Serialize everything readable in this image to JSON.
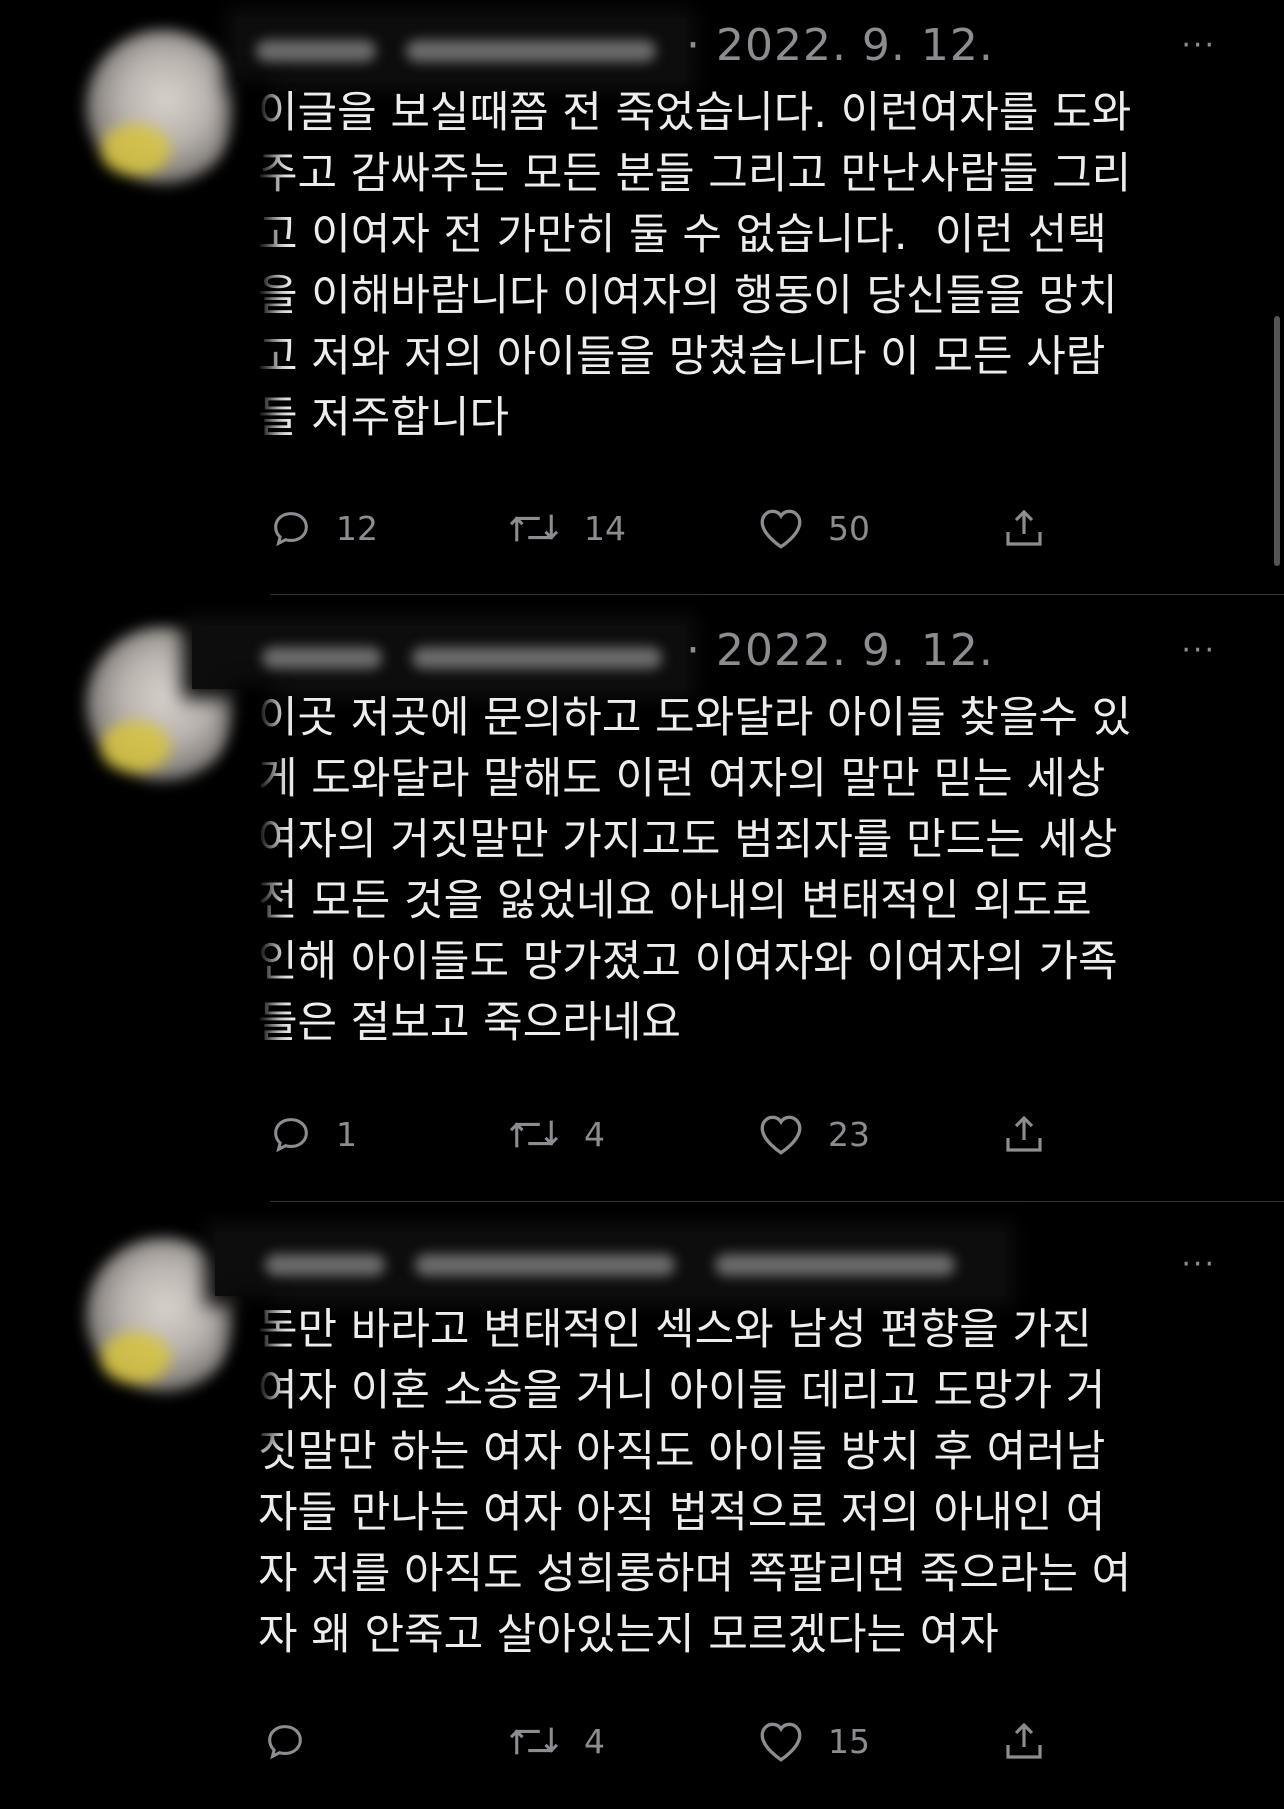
{
  "tweets": [
    {
      "date": "· 2022. 9. 12.",
      "more": "···",
      "text": "이글을 보실때쯤 전 죽었습니다. 이런여자를 도와\n주고 감싸주는 모든 분들 그리고 만난사람들 그리\n고 이여자 전 가만히 둘 수 없습니다.  이런 선택\n을 이해바람니다 이여자의 행동이 당신들을 망치\n고 저와 저의 아이들을 망쳤습니다 이 모든 사람\n들 저주합니다",
      "replies": "12",
      "retweets": "14",
      "likes": "50"
    },
    {
      "date": "· 2022. 9. 12.",
      "more": "···",
      "text": "이곳 저곳에 문의하고 도와달라 아이들 찾을수 있\n게 도와달라 말해도 이런 여자의 말만 믿는 세상\n여자의 거짓말만 가지고도 범죄자를 만드는 세상\n전 모든 것을 잃었네요 아내의 변태적인 외도로\n인해 아이들도 망가졌고 이여자와 이여자의 가족\n들은 절보고 죽으라네요",
      "replies": "1",
      "retweets": "4",
      "likes": "23"
    },
    {
      "date": "",
      "more": "···",
      "text": "돈만 바라고 변태적인 섹스와 남성 편향을 가진\n여자 이혼 소송을 거니 아이들 데리고 도망가 거\n짓말만 하는 여자 아직도 아이들 방치 후 여러남\n자들 만나는 여자 아직 법적으로 저의 아내인 여\n자 저를 아직도 성희롱하며 쪽팔리면 죽으라는 여\n자 왜 안죽고 살아있는지 모르겠다는 여자",
      "replies": "",
      "retweets": "4",
      "likes": "15"
    }
  ],
  "icons": {
    "reply": "reply-icon",
    "retweet": "retweet-icon",
    "like": "heart-icon",
    "share": "share-icon",
    "more": "more-icon"
  },
  "colors": {
    "background": "#000000",
    "text": "#ededed",
    "muted": "#8b8d90"
  }
}
